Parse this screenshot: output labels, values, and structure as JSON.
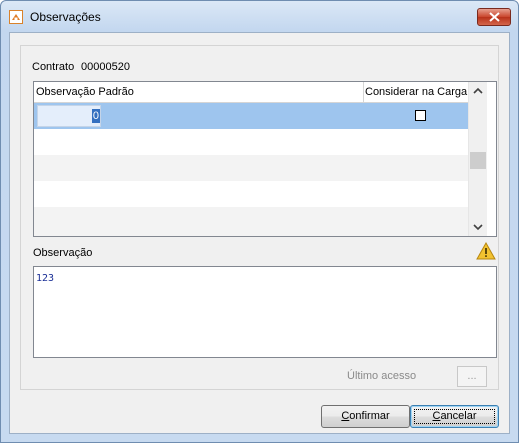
{
  "window": {
    "title": "Observações",
    "close_icon": "close-icon"
  },
  "contract": {
    "label": "Contrato",
    "number": "00000520"
  },
  "grid": {
    "columns": [
      "Observação Padrão",
      "Considerar na Carga"
    ],
    "rows": [
      {
        "observacao_padrao": "0",
        "considerar_na_carga": false,
        "selected": true
      }
    ],
    "empty_rows": 4
  },
  "observacao": {
    "label": "Observação",
    "value": "123",
    "warning_icon": "warning-icon"
  },
  "ultimo_acesso": {
    "label": "Último acesso",
    "button_label": "..."
  },
  "buttons": {
    "confirm": {
      "accel": "C",
      "rest": "onfirmar"
    },
    "cancel": {
      "accel": "C",
      "rest": "ancelar"
    }
  },
  "colors": {
    "selection": "#9ec5ee",
    "memo_text": "#1a2f96",
    "close_button": "#c9452c"
  }
}
